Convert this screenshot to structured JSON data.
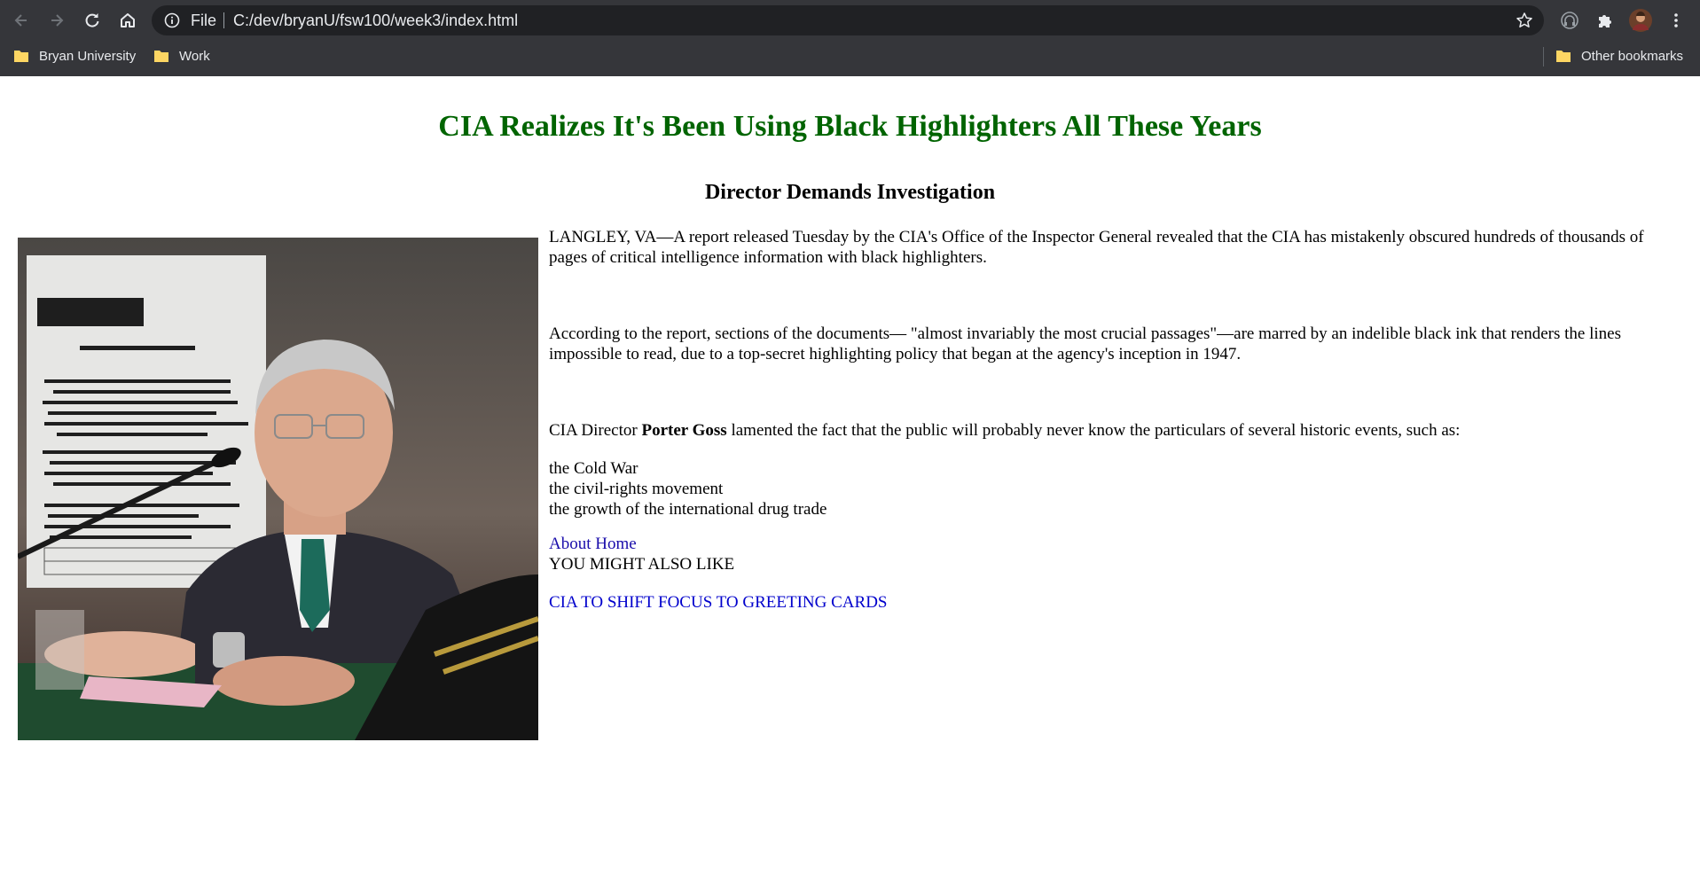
{
  "browser": {
    "omnibox_scheme": "File",
    "url": "C:/dev/bryanU/fsw100/week3/index.html",
    "bookmarks": [
      {
        "label": "Bryan University"
      },
      {
        "label": "Work"
      }
    ],
    "other_bookmarks": "Other bookmarks",
    "colors": {
      "chrome": "#35363a",
      "omnibox": "#202124",
      "text": "#e8eaed",
      "folder": "#fdd663"
    }
  },
  "article": {
    "headline": "CIA Realizes It's Been Using Black Highlighters All These Years",
    "subhead": "Director Demands Investigation",
    "p1": "LANGLEY, VA—A report released Tuesday by the CIA's Office of the Inspector General revealed that the CIA has mistakenly obscured hundreds of thousands of pages of critical intelligence information with black highlighters.",
    "p2": "According to the report, sections of the documents— \"almost invariably the most crucial passages\"—are marred by an indelible black ink that renders the lines impossible to read, due to a top-secret highlighting policy that began at the agency's inception in 1947.",
    "p3_before": "CIA Director ",
    "p3_bold": "Porter Goss",
    "p3_after": " lamented the fact that the public will probably never know the particulars of several historic events, such as:",
    "events": [
      "the Cold War",
      "the civil-rights movement",
      "the growth of the international drug trade"
    ],
    "nav_about": "About",
    "nav_home": "Home",
    "also_like": "YOU MIGHT ALSO LIKE",
    "related_link": "CIA TO SHIFT FOCUS TO GREETING CARDS",
    "headline_color": "#006400"
  }
}
